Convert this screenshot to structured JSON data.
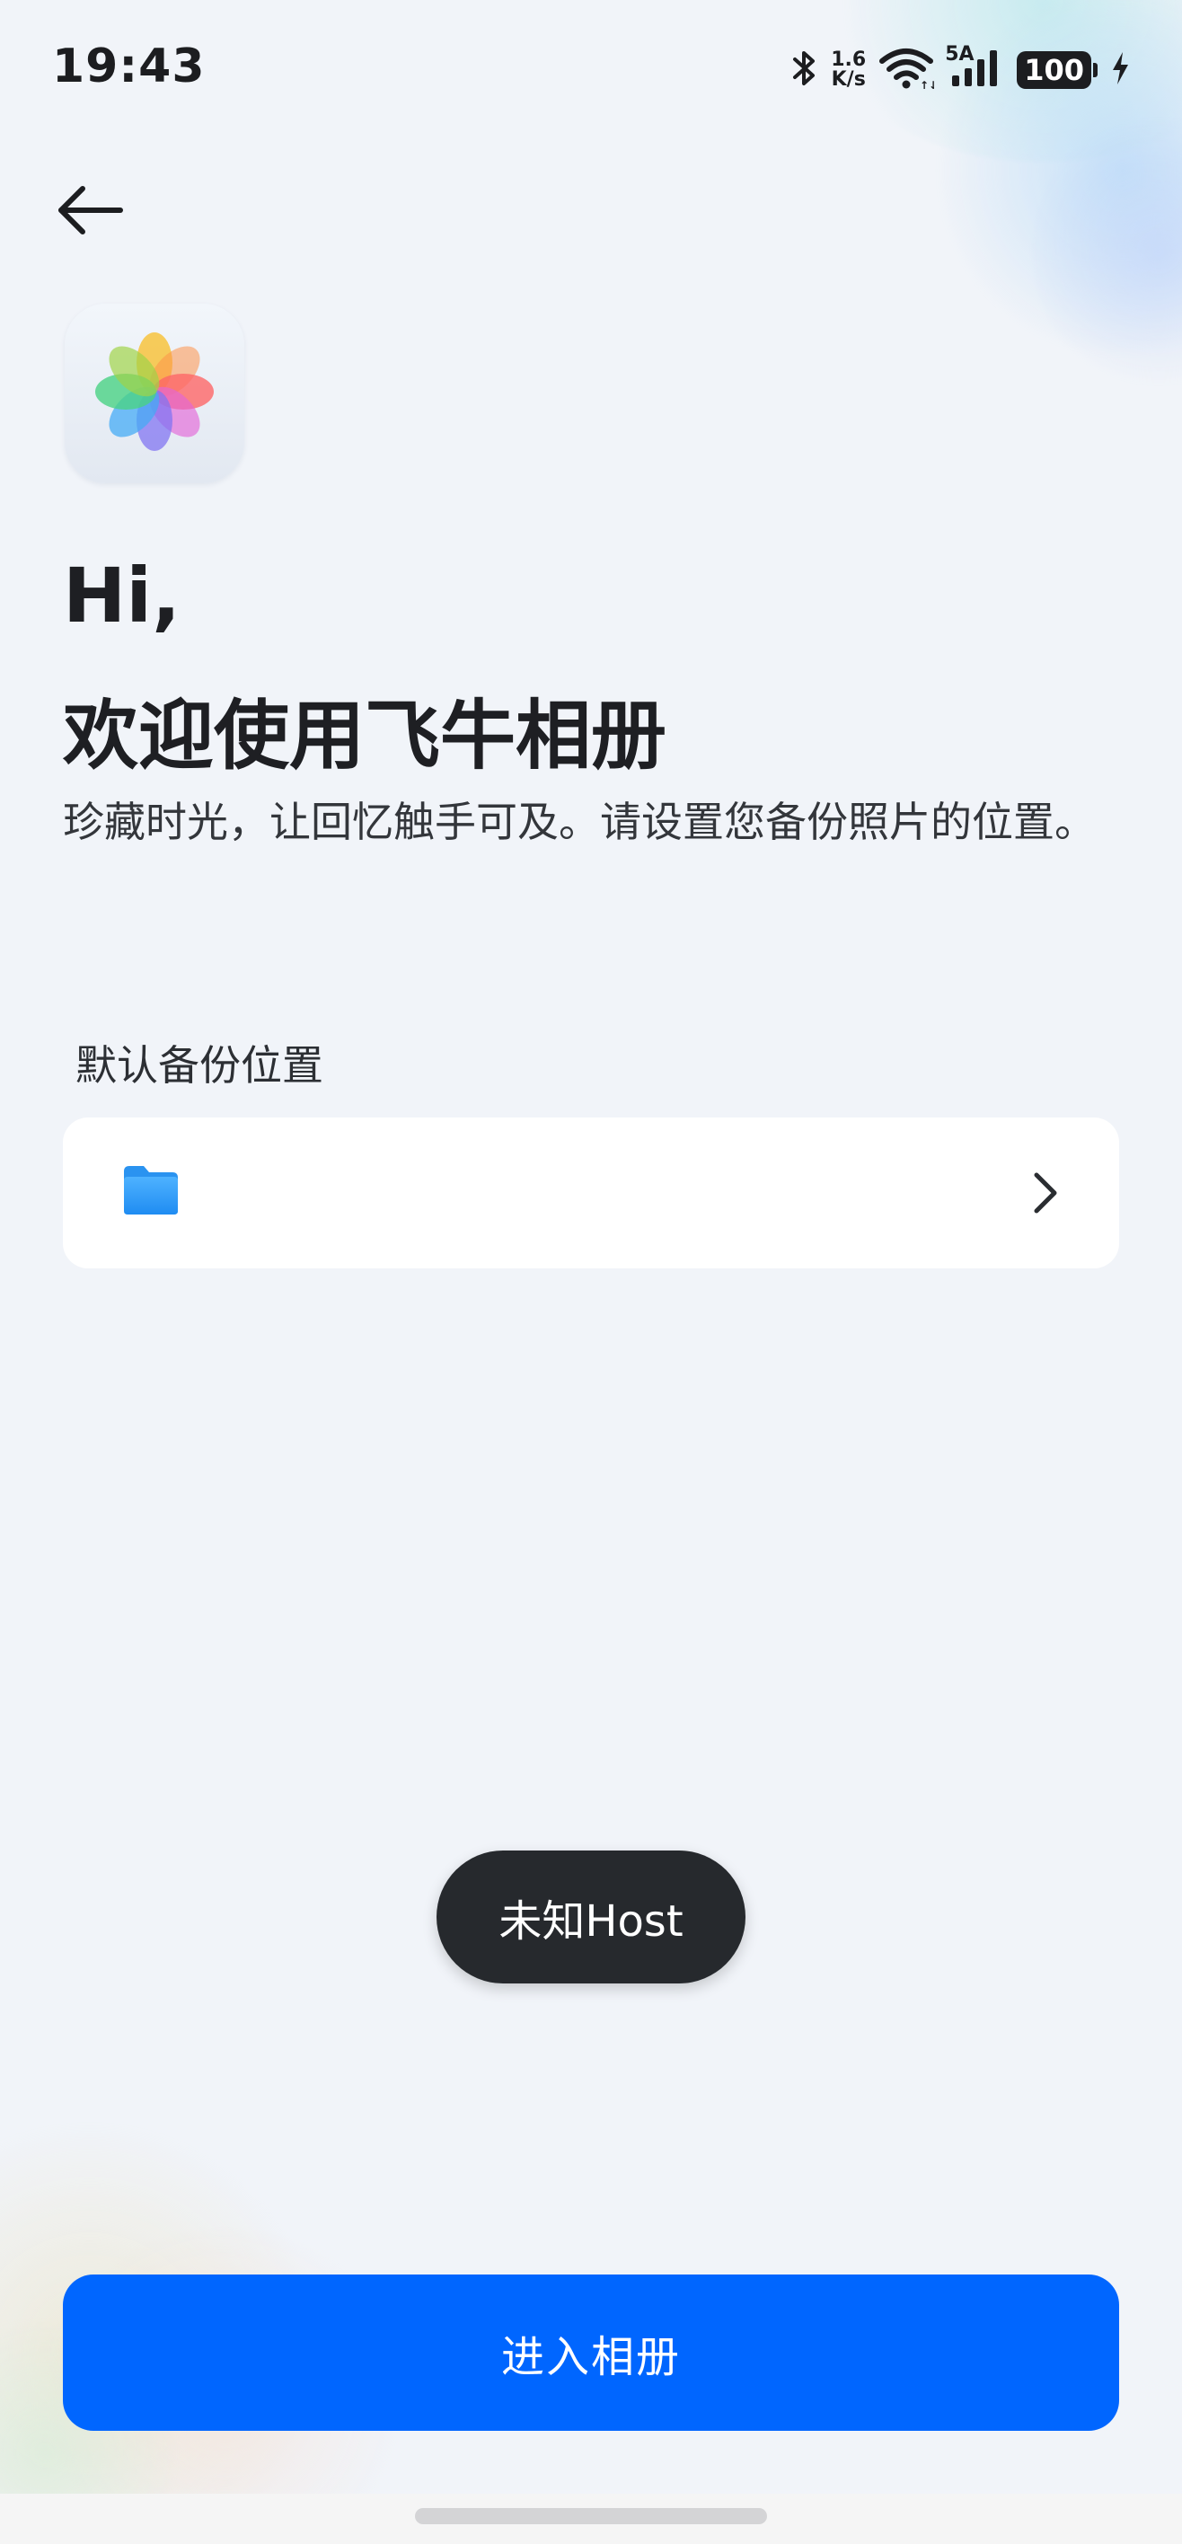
{
  "status_bar": {
    "time": "19:43",
    "net_speed_value": "1.6",
    "net_speed_unit": "K/s",
    "signal_label": "5A",
    "battery": "100",
    "icons": [
      "bluetooth-icon",
      "wifi-icon",
      "cell-signal-icon",
      "battery-icon",
      "charging-icon"
    ]
  },
  "header": {
    "back_icon": "arrow-left-icon"
  },
  "app": {
    "icon": "photos-flower-icon"
  },
  "welcome": {
    "greeting": "Hi,",
    "title": "欢迎使用飞牛相册",
    "subtitle": "珍藏时光，让回忆触手可及。请设置您备份照片的位置。"
  },
  "backup": {
    "section_label": "默认备份位置",
    "location_value": "",
    "folder_icon": "folder-icon",
    "chevron_icon": "chevron-right-icon"
  },
  "toast": {
    "message": "未知Host"
  },
  "actions": {
    "enter_album_label": "进入相册"
  },
  "colors": {
    "primary": "#0066ff",
    "background": "#f1f4f9",
    "toast_bg": "#26292d",
    "card_bg": "#ffffff"
  }
}
